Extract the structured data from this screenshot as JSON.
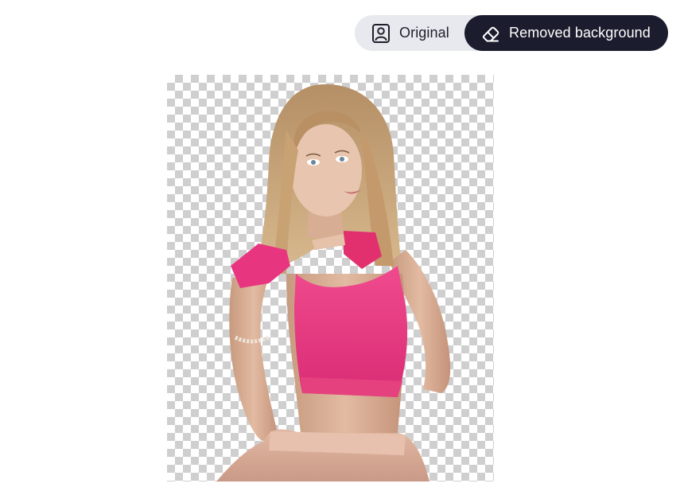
{
  "view_toggle": {
    "original_label": "Original",
    "removed_label": "Removed background",
    "original_icon": "portrait-icon",
    "removed_icon": "eraser-icon",
    "selected": "Removed background"
  },
  "colors": {
    "toggle_bg": "#e8e9ee",
    "active_bg": "#1b1d2e",
    "active_text": "#ffffff",
    "inactive_text": "#1d1f2b",
    "checker": "#cfcfcf",
    "top_pink": "#e8357f"
  }
}
